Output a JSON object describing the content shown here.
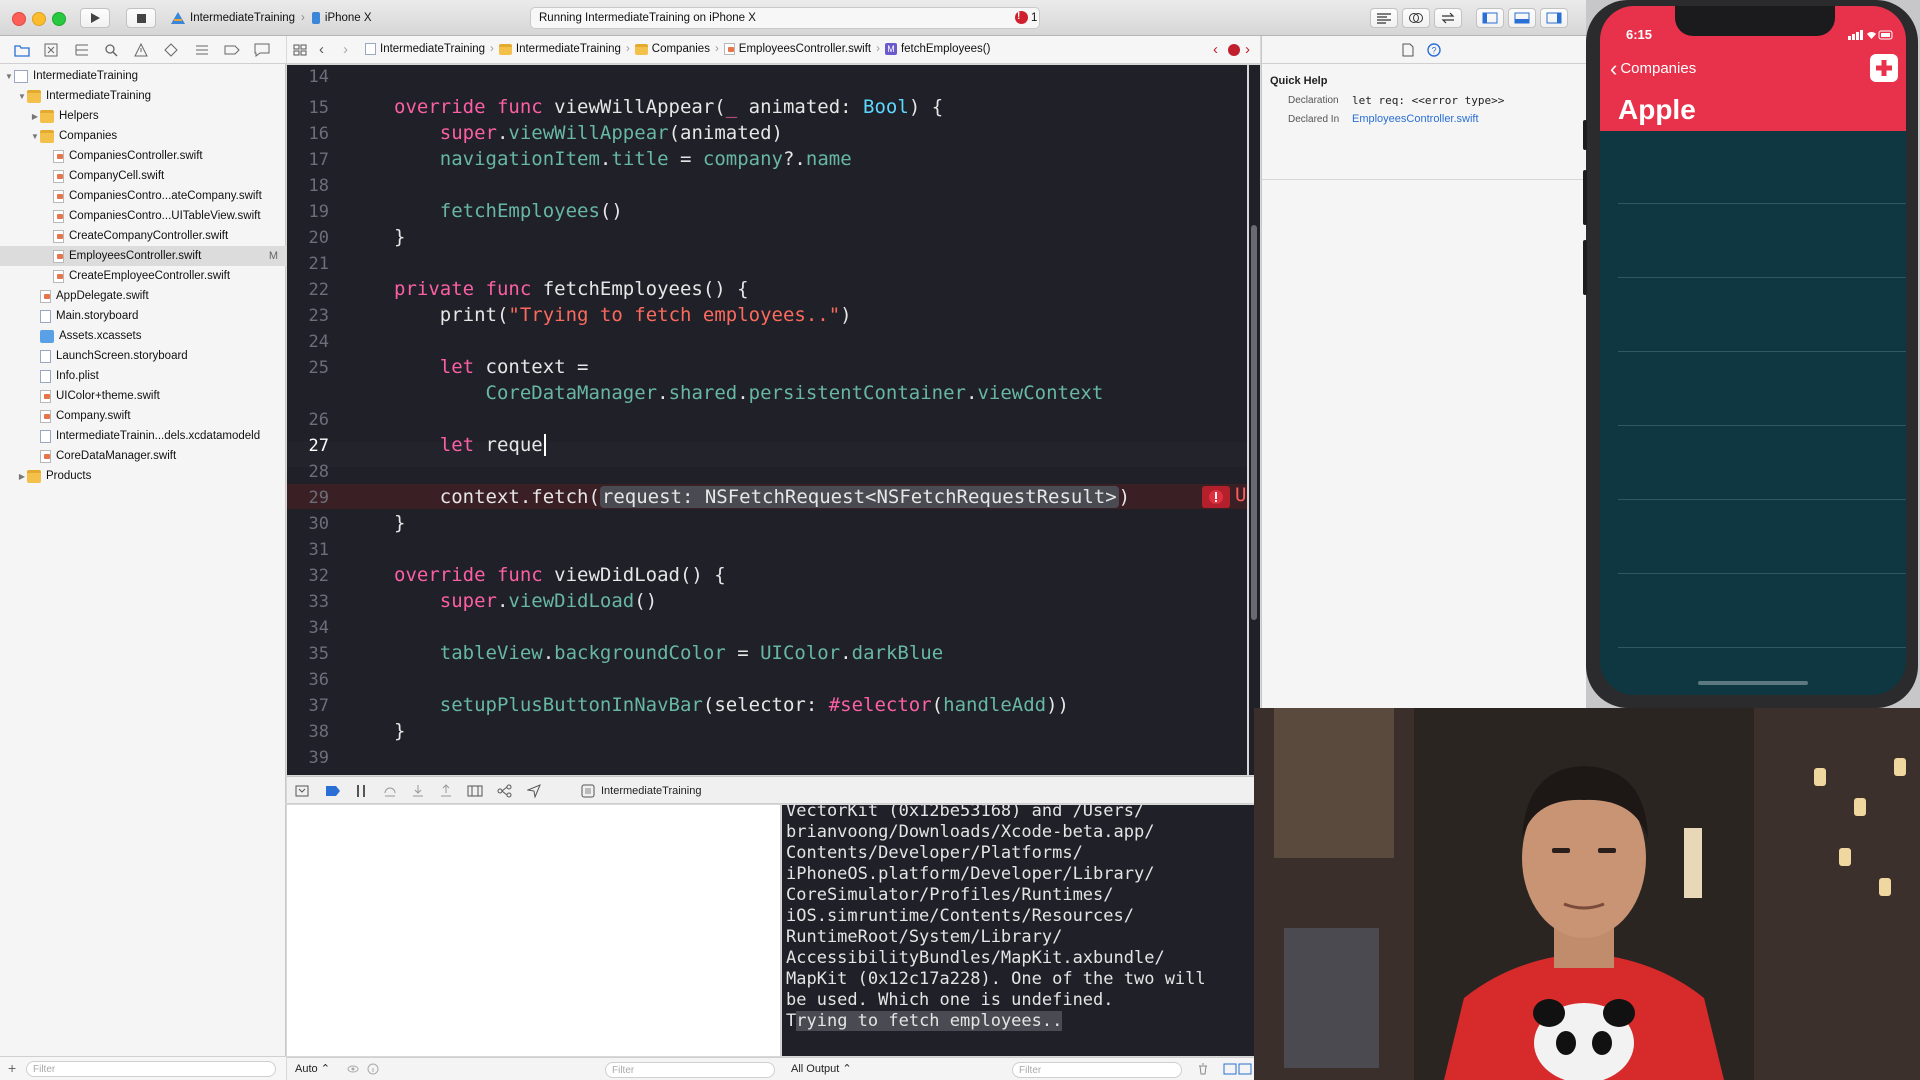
{
  "toolbar": {
    "scheme_name": "IntermediateTraining",
    "device_name": "iPhone X",
    "activity_text": "Running IntermediateTraining on iPhone X",
    "issue_count": "1"
  },
  "navigator": {
    "items": [
      {
        "label": "IntermediateTraining",
        "kind": "project",
        "depth": 0,
        "disclosure": "open"
      },
      {
        "label": "IntermediateTraining",
        "kind": "folder",
        "depth": 1,
        "disclosure": "open"
      },
      {
        "label": "Helpers",
        "kind": "folder",
        "depth": 2,
        "disclosure": "closed"
      },
      {
        "label": "Companies",
        "kind": "folder",
        "depth": 2,
        "disclosure": "open"
      },
      {
        "label": "CompaniesController.swift",
        "kind": "swift",
        "depth": 3
      },
      {
        "label": "CompanyCell.swift",
        "kind": "swift",
        "depth": 3
      },
      {
        "label": "CompaniesContro...ateCompany.swift",
        "kind": "swift",
        "depth": 3
      },
      {
        "label": "CompaniesContro...UITableView.swift",
        "kind": "swift",
        "depth": 3
      },
      {
        "label": "CreateCompanyController.swift",
        "kind": "swift",
        "depth": 3
      },
      {
        "label": "EmployeesController.swift",
        "kind": "swift",
        "depth": 3,
        "selected": true,
        "badge": "M"
      },
      {
        "label": "CreateEmployeeController.swift",
        "kind": "swift",
        "depth": 3
      },
      {
        "label": "AppDelegate.swift",
        "kind": "swift",
        "depth": 2
      },
      {
        "label": "Main.storyboard",
        "kind": "storyboard",
        "depth": 2
      },
      {
        "label": "Assets.xcassets",
        "kind": "asset",
        "depth": 2
      },
      {
        "label": "LaunchScreen.storyboard",
        "kind": "storyboard",
        "depth": 2
      },
      {
        "label": "Info.plist",
        "kind": "plist",
        "depth": 2
      },
      {
        "label": "UIColor+theme.swift",
        "kind": "swift",
        "depth": 2
      },
      {
        "label": "Company.swift",
        "kind": "swift",
        "depth": 2
      },
      {
        "label": "IntermediateTrainin...dels.xcdatamodeld",
        "kind": "xcdatamodel",
        "depth": 2
      },
      {
        "label": "CoreDataManager.swift",
        "kind": "swift",
        "depth": 2
      },
      {
        "label": "Products",
        "kind": "folder",
        "depth": 1,
        "disclosure": "closed"
      }
    ],
    "filter_placeholder": "Filter"
  },
  "jumpbar": {
    "crumbs": [
      "IntermediateTraining",
      "IntermediateTraining",
      "Companies",
      "EmployeesController.swift",
      "fetchEmployees()"
    ]
  },
  "editor": {
    "line_numbers": [
      "14",
      "15",
      "16",
      "17",
      "18",
      "19",
      "20",
      "21",
      "22",
      "23",
      "24",
      "25",
      "",
      "26",
      "27",
      "28",
      "29",
      "30",
      "31",
      "32",
      "33",
      "34",
      "35",
      "36",
      "37",
      "38",
      "39"
    ],
    "current_line": "27",
    "error_line": "29",
    "error_text": "U"
  },
  "quick_help": {
    "title": "Quick Help",
    "declaration_label": "Declaration",
    "declaration_value": "let req: <<error type>>",
    "declared_in_label": "Declared In",
    "declared_in_value": "EmployeesController.swift"
  },
  "debug": {
    "target_name": "IntermediateTraining",
    "console_lines": [
      "VectorKit (0x12be53168) and /Users/",
      "brianvoong/Downloads/Xcode-beta.app/",
      "Contents/Developer/Platforms/",
      "iPhoneOS.platform/Developer/Library/",
      "CoreSimulator/Profiles/Runtimes/",
      "iOS.simruntime/Contents/Resources/",
      "RuntimeRoot/System/Library/",
      "AccessibilityBundles/MapKit.axbundle/",
      "MapKit (0x12c17a228). One of the two will",
      "be used. Which one is undefined."
    ],
    "console_last_prefix": "T",
    "console_last_highlight": "rying to fetch employees..",
    "auto_label": "Auto",
    "output_label": "All Output",
    "filter_placeholder": "Filter"
  },
  "simulator": {
    "time": "6:15",
    "back_label": "Companies",
    "title": "Apple",
    "nav_color": "#e8324b",
    "table_color": "#0f3741"
  },
  "colors": {
    "keyword": "#fc5fa3",
    "type": "#5dd8ff",
    "function": "#67b7a4",
    "string": "#fc6a5d",
    "error": "#b3202c"
  }
}
